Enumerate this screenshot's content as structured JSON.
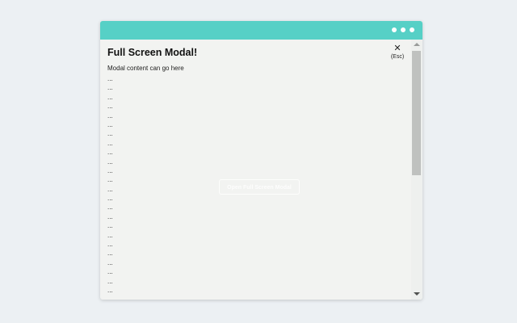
{
  "colors": {
    "titlebar": "#56d0c6",
    "page_background": "#ecf0f3",
    "modal_background": "#f2f3f1"
  },
  "modal": {
    "title": "Full Screen Modal!",
    "text": "Modal content can go here",
    "lines": [
      "...",
      "...",
      "...",
      "...",
      "...",
      "...",
      "...",
      "...",
      "...",
      "...",
      "...",
      "...",
      "...",
      "...",
      "...",
      "...",
      "...",
      "...",
      "...",
      "...",
      "...",
      "...",
      "...",
      "...",
      "..."
    ],
    "close": {
      "icon": "close-icon",
      "symbol": "✕",
      "hint": "(Esc)"
    }
  },
  "background_button": {
    "label": "Open Full Screen Modal"
  },
  "window_controls": [
    "dot",
    "dot",
    "dot"
  ]
}
